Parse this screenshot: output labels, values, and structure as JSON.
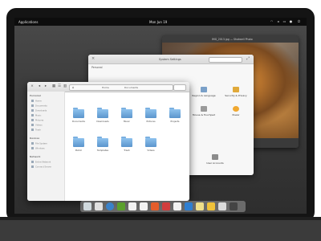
{
  "topbar": {
    "applications": "Applications",
    "clock": "Mon Jun 19",
    "indicators": [
      "wifi-icon",
      "volume-icon",
      "battery-icon",
      "user-icon",
      "power-icon"
    ]
  },
  "photo_window": {
    "title": "IMG_2013.jpg — Shotwell Photo"
  },
  "settings": {
    "title": "System Settings",
    "section": "Personal",
    "items": [
      {
        "label": "Applications",
        "icon": "applications-icon",
        "color": "#6c6c6c"
      },
      {
        "label": "Desktop",
        "icon": "desktop-icon",
        "color": "#4a86c5"
      },
      {
        "label": "Notifications",
        "icon": "notifications-icon",
        "color": "#d64a3a"
      },
      {
        "label": "Region & Language",
        "icon": "region-icon",
        "color": "#7aa0c8"
      },
      {
        "label": "Security & Privacy",
        "icon": "lock-icon",
        "color": "#e0a93a"
      },
      {
        "label": "Mouse & Touchpad",
        "icon": "mouse-icon",
        "color": "#9a9a9a"
      },
      {
        "label": "Power",
        "icon": "power-icon",
        "color": "#f0a830"
      },
      {
        "label": "User Accounts",
        "icon": "user-accounts-icon",
        "color": "#8c8c8c"
      }
    ]
  },
  "files": {
    "breadcrumb": [
      "Home",
      "Documents"
    ],
    "sidebar": {
      "personal_header": "Personal",
      "personal_items": [
        "Home",
        "Documents",
        "Downloads",
        "Music",
        "Pictures",
        "Videos",
        "Trash"
      ],
      "devices_header": "Devices",
      "devices_items": [
        "File System",
        "Windows"
      ],
      "network_header": "Network",
      "network_items": [
        "Entire Network",
        "Connect Server"
      ]
    },
    "folders": [
      {
        "label": "Documents"
      },
      {
        "label": "Downloads"
      },
      {
        "label": "Music"
      },
      {
        "label": "Pictures"
      },
      {
        "label": "Projects"
      },
      {
        "label": "Public"
      },
      {
        "label": "Templates"
      },
      {
        "label": "Trash"
      },
      {
        "label": "Videos"
      }
    ]
  },
  "dock": {
    "apps": [
      {
        "name": "files-icon",
        "color": "#cfd8dc"
      },
      {
        "name": "terminal-icon",
        "color": "#e0e0e0"
      },
      {
        "name": "browser-icon",
        "color": "#3a82c9"
      },
      {
        "name": "mail-icon",
        "color": "#5aa02c"
      },
      {
        "name": "calendar-icon",
        "color": "#f2f2f2"
      },
      {
        "name": "music-icon",
        "color": "#f2f2f2"
      },
      {
        "name": "video-icon",
        "color": "#e35d2b"
      },
      {
        "name": "photos-icon",
        "color": "#d13d3d"
      },
      {
        "name": "contacts-icon",
        "color": "#f2f2f2"
      },
      {
        "name": "chat-icon",
        "color": "#2f7fd1"
      },
      {
        "name": "notes-icon",
        "color": "#f0e08a"
      },
      {
        "name": "store-icon",
        "color": "#f0c23a"
      },
      {
        "name": "settings-icon",
        "color": "#dcdcdc"
      },
      {
        "name": "display-icon",
        "color": "#444444"
      }
    ]
  }
}
